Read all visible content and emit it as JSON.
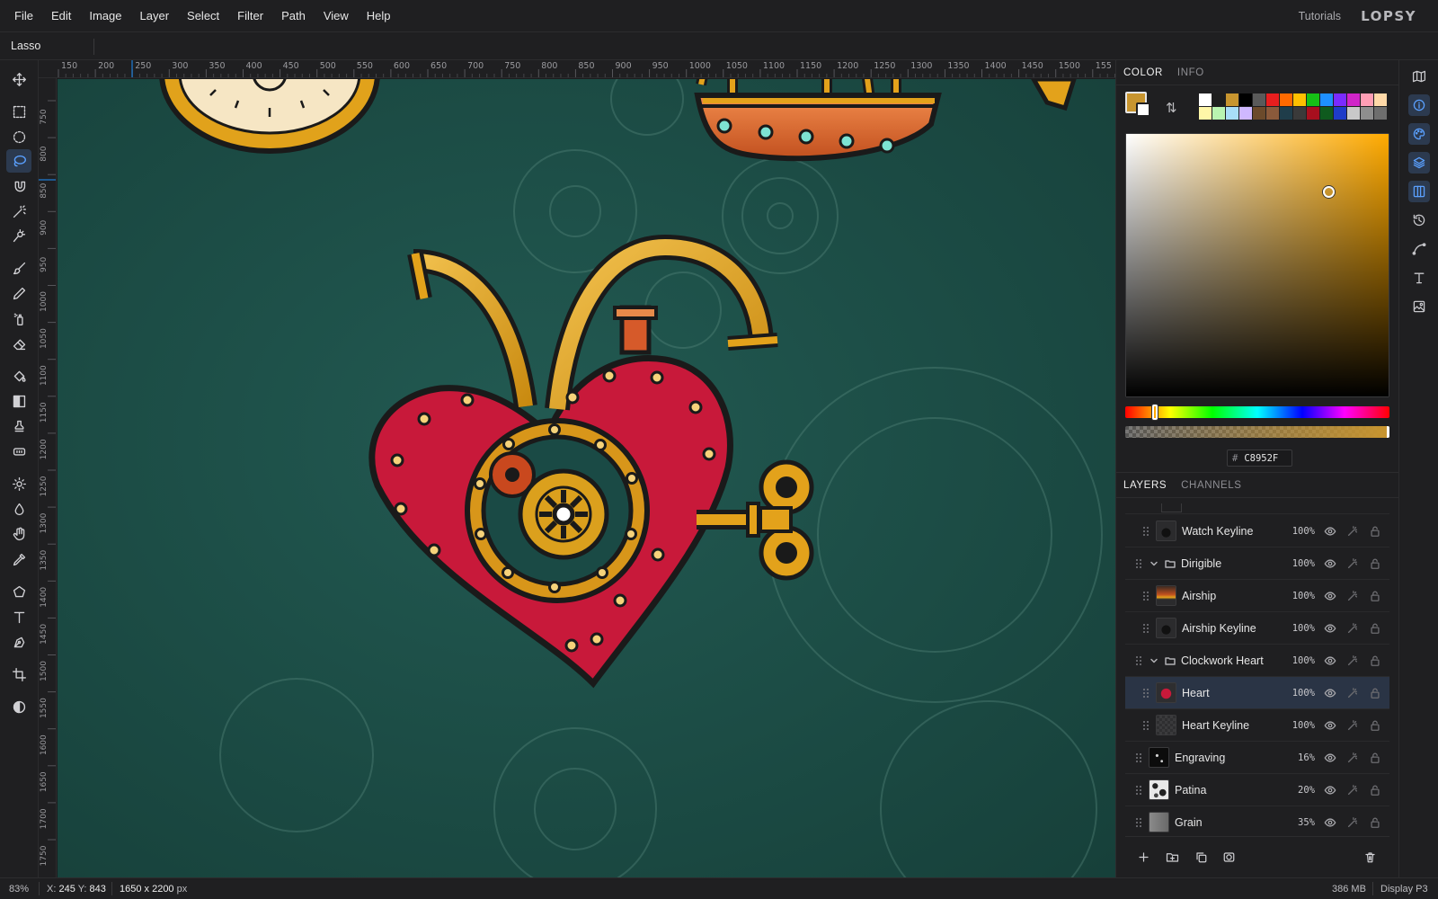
{
  "menubar": {
    "items": [
      "File",
      "Edit",
      "Image",
      "Layer",
      "Select",
      "Filter",
      "Path",
      "View",
      "Help"
    ],
    "tutorials": "Tutorials",
    "logo": "LOPSY"
  },
  "options_bar": {
    "tool_name": "Lasso"
  },
  "toolbar": {
    "tools": [
      "move-tool",
      "rect-marquee-tool",
      "ellipse-marquee-tool",
      "lasso-tool",
      "magnetic-lasso-tool",
      "magic-wand-tool",
      "quick-select-tool",
      "brush-tool",
      "pencil-tool",
      "spray-tool",
      "eraser-tool",
      "paint-bucket-tool",
      "gradient-tool",
      "clone-stamp-tool",
      "heal-tool",
      "dodge-tool",
      "burn-tool",
      "smudge-tool",
      "eyedropper-tool",
      "shape-tool",
      "text-tool",
      "pen-tool",
      "crop-tool",
      "mask-toggle-tool"
    ],
    "active_tool": "lasso-tool"
  },
  "rulers": {
    "top_labels": [
      "150",
      "200",
      "250",
      "300",
      "350",
      "400",
      "450",
      "500",
      "550",
      "600",
      "650",
      "700",
      "750",
      "800",
      "850",
      "900",
      "950",
      "1000",
      "1050",
      "1100",
      "1150",
      "1200",
      "1250",
      "1300",
      "1350",
      "1400",
      "1450",
      "1500",
      "155"
    ],
    "left_labels": [
      "750",
      "800",
      "850",
      "900",
      "950",
      "1000",
      "1050",
      "1100",
      "1150",
      "1200",
      "1250",
      "1300",
      "1350",
      "1400",
      "1450",
      "1500",
      "1550",
      "1600",
      "1650",
      "1700",
      "1750"
    ]
  },
  "color_panel": {
    "tabs": [
      "COLOR",
      "INFO"
    ],
    "active_tab": "COLOR",
    "foreground": "#C8952F",
    "background": "#FFFFFF",
    "swatches": [
      "#FFFFFF",
      "#1E1E1E",
      "#C8952F",
      "#000000",
      "#5A5A5A",
      "#E81E1E",
      "#FF6A00",
      "#FFC000",
      "#16C016",
      "#1E90FF",
      "#7A2BFF",
      "#D025C8",
      "#FF9EB5",
      "#FFD9A8",
      "#FFF7A8",
      "#B9F5B0",
      "#A8DDF7",
      "#CFB8FF",
      "#6B4A2B",
      "#8A5A3B",
      "#1F3D4A",
      "#3A3A3A",
      "#A80F1E",
      "#0F5A1E",
      "#1E3CC8",
      "#C9C9C9",
      "#8E8E8E",
      "#6E6E6E"
    ],
    "hex_label": "#",
    "hex_value": "C8952F",
    "hue_degrees": 40,
    "saturation": 0.77,
    "brightness": 0.78,
    "alpha_percent": 100
  },
  "layers_panel": {
    "tabs": [
      "LAYERS",
      "CHANNELS"
    ],
    "active_tab": "LAYERS",
    "layers": [
      {
        "name": "Watch Keyline",
        "opacity": "100%",
        "kind": "layer",
        "indent": 1,
        "thumb": "dark-keyline"
      },
      {
        "name": "Dirigible",
        "opacity": "100%",
        "kind": "group",
        "indent": 0
      },
      {
        "name": "Airship",
        "opacity": "100%",
        "kind": "layer",
        "indent": 1,
        "thumb": "airship"
      },
      {
        "name": "Airship Keyline",
        "opacity": "100%",
        "kind": "layer",
        "indent": 1,
        "thumb": "dark-keyline"
      },
      {
        "name": "Clockwork Heart",
        "opacity": "100%",
        "kind": "group",
        "indent": 0
      },
      {
        "name": "Heart",
        "opacity": "100%",
        "kind": "layer",
        "indent": 1,
        "thumb": "heart",
        "selected": true
      },
      {
        "name": "Heart Keyline",
        "opacity": "100%",
        "kind": "layer",
        "indent": 1,
        "thumb": "empty"
      },
      {
        "name": "Engraving",
        "opacity": "16%",
        "kind": "layer",
        "indent": 0,
        "thumb": "engraving"
      },
      {
        "name": "Patina",
        "opacity": "20%",
        "kind": "layer",
        "indent": 0,
        "thumb": "patina"
      },
      {
        "name": "Grain",
        "opacity": "35%",
        "kind": "layer",
        "indent": 0,
        "thumb": "grain"
      }
    ],
    "actions": [
      "new-layer-icon",
      "new-group-icon",
      "duplicate-layer-icon",
      "mask-icon",
      "delete-layer-icon"
    ]
  },
  "right_strip": {
    "icons": [
      "navigator-icon",
      "info-icon",
      "color-palette-icon",
      "layers-icon",
      "channels-icon",
      "history-icon",
      "paths-icon",
      "type-icon",
      "image-adjust-icon"
    ],
    "active": [
      "info-icon",
      "color-palette-icon",
      "layers-icon",
      "channels-icon"
    ]
  },
  "statusbar": {
    "zoom": "83%",
    "x_label": "X:",
    "x_value": "245",
    "y_label": "Y:",
    "y_value": "843",
    "doc_size": "1650 x 2200",
    "doc_unit": "px",
    "memory": "386 MB",
    "color_profile": "Display P3"
  },
  "colors": {
    "accent": "#1E90FF",
    "canvas_bg": "#1D4E47",
    "heart_red": "#C8193A",
    "brass": "#D99A1B"
  }
}
